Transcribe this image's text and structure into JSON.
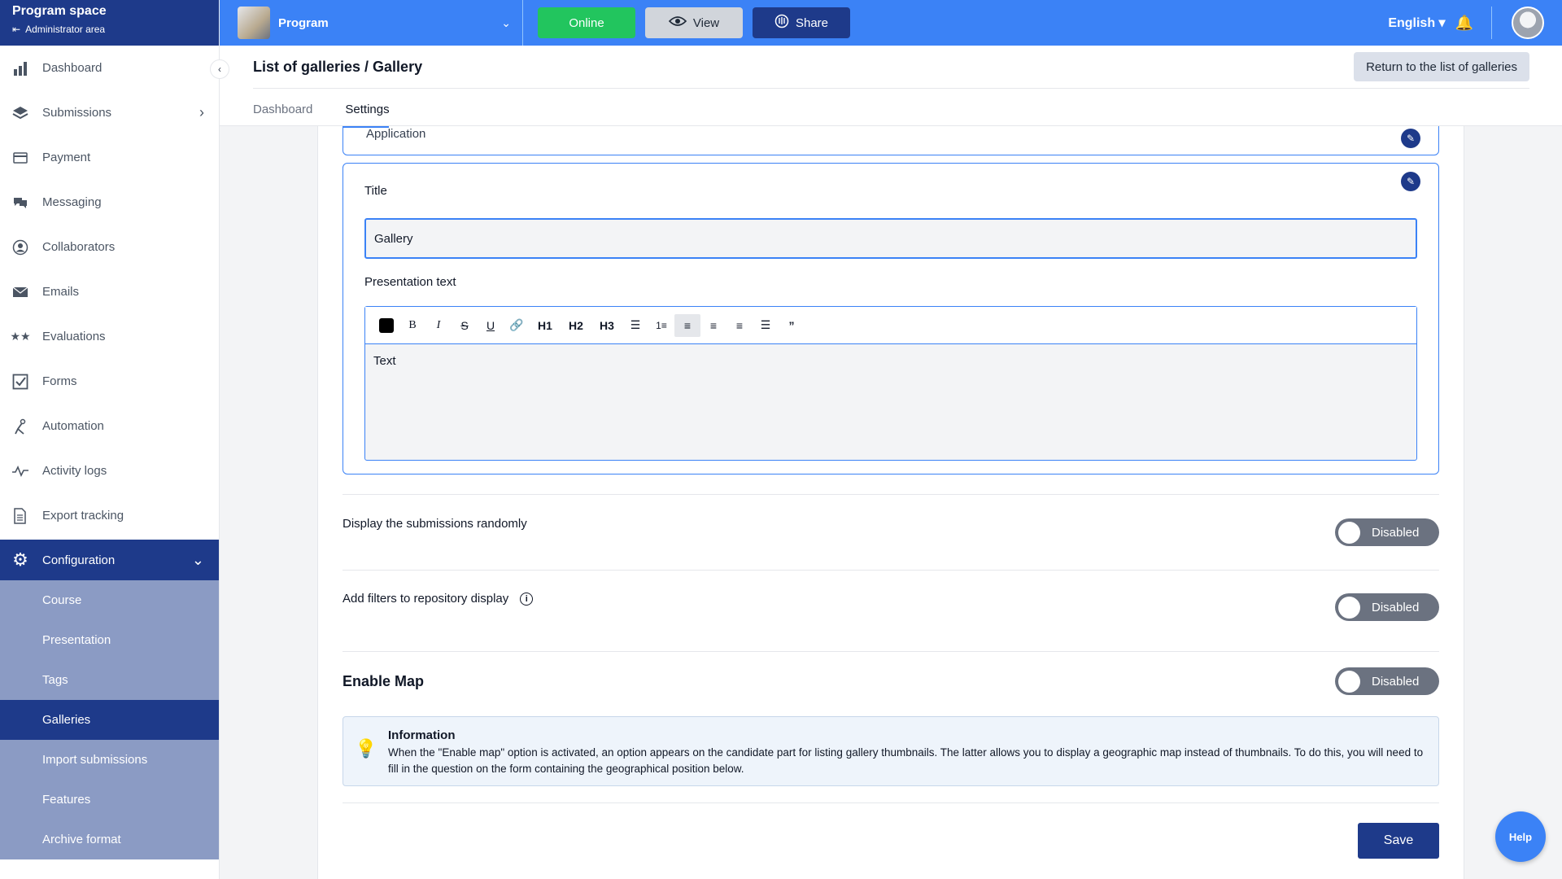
{
  "sidebar": {
    "title": "Program space",
    "admin_link": "Administrator area",
    "items": [
      {
        "label": "Dashboard",
        "icon": "bar-chart-icon"
      },
      {
        "label": "Submissions",
        "icon": "layers-icon"
      },
      {
        "label": "Payment",
        "icon": "credit-card-icon"
      },
      {
        "label": "Messaging",
        "icon": "chat-icon"
      },
      {
        "label": "Collaborators",
        "icon": "user-circle-icon"
      },
      {
        "label": "Emails",
        "icon": "envelope-icon"
      },
      {
        "label": "Evaluations",
        "icon": "stars-icon"
      },
      {
        "label": "Forms",
        "icon": "checkbox-icon"
      },
      {
        "label": "Automation",
        "icon": "automation-icon"
      },
      {
        "label": "Activity logs",
        "icon": "pulse-icon"
      },
      {
        "label": "Export tracking",
        "icon": "document-icon"
      }
    ],
    "config": {
      "label": "Configuration",
      "icon": "gear-icon"
    },
    "sub_items": [
      {
        "label": "Course"
      },
      {
        "label": "Presentation"
      },
      {
        "label": "Tags"
      },
      {
        "label": "Galleries"
      },
      {
        "label": "Import submissions"
      },
      {
        "label": "Features"
      },
      {
        "label": "Archive format"
      }
    ]
  },
  "topbar": {
    "program_name": "Program",
    "online_label": "Online",
    "view_label": "View",
    "share_label": "Share",
    "language": "English"
  },
  "header": {
    "breadcrumb": "List of galleries / Gallery",
    "return_label": "Return to the list of galleries",
    "tabs": [
      {
        "label": "Dashboard"
      },
      {
        "label": "Settings"
      }
    ]
  },
  "form": {
    "prev_card_label": "Application",
    "title_label": "Title",
    "title_value": "Gallery",
    "presentation_label": "Presentation text",
    "editor_text": "Text",
    "toolbar": {
      "h1": "H1",
      "h2": "H2",
      "h3": "H3"
    },
    "random_label": "Display the submissions randomly",
    "random_state": "Disabled",
    "filters_label": "Add filters to repository display",
    "filters_state": "Disabled",
    "map_label": "Enable Map",
    "map_state": "Disabled",
    "info_title": "Information",
    "info_text": "When the \"Enable map\" option is activated, an option appears on the candidate part for listing gallery thumbnails. The latter allows you to display a geographic map instead of thumbnails. To do this, you will need to fill in the question on the form containing the geographical position below.",
    "save_label": "Save"
  },
  "help_label": "Help",
  "colors": {
    "primary": "#3b82f6",
    "dark": "#1e3a8a",
    "online": "#22c55e",
    "submenu": "#8b9bc4"
  }
}
